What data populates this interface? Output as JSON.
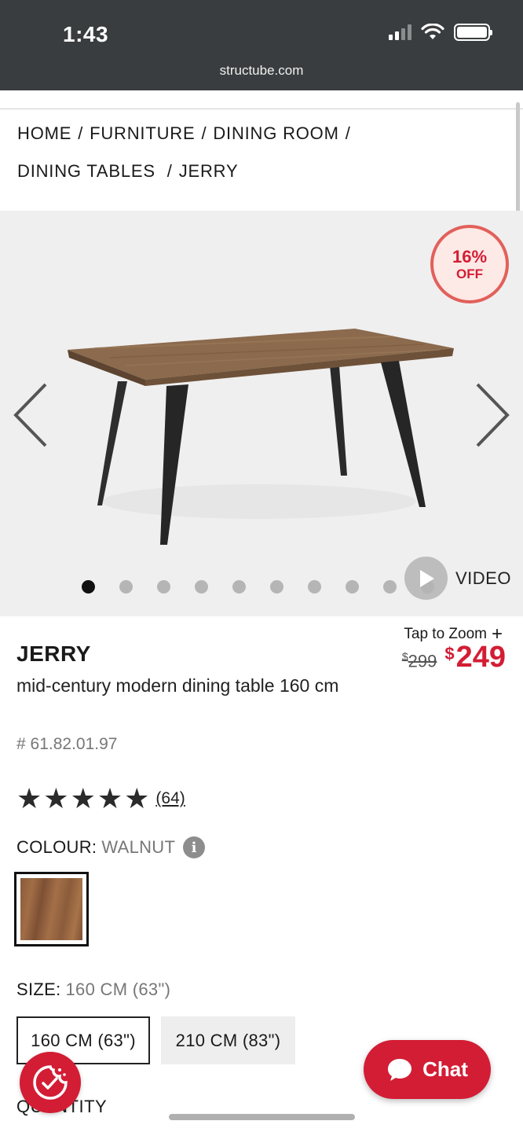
{
  "status_bar": {
    "time": "1:43"
  },
  "browser": {
    "url": "structube.com"
  },
  "breadcrumb": {
    "items": [
      "HOME",
      "FURNITURE",
      "DINING ROOM",
      "DINING TABLES",
      "JERRY"
    ],
    "separator": "/"
  },
  "gallery": {
    "badge": {
      "percent": "16%",
      "label": "OFF"
    },
    "total_images": 10,
    "active_index": 0,
    "video_label": "VIDEO"
  },
  "product": {
    "tap_to_zoom": "Tap to Zoom",
    "name": "JERRY",
    "description": "mid-century modern dining table 160 cm",
    "sku": "# 61.82.01.97",
    "rating": {
      "stars": 5,
      "count_label": "(64)"
    },
    "price": {
      "currency": "$",
      "old": "299",
      "new": "249"
    },
    "colour": {
      "label": "COLOUR:",
      "value": "WALNUT",
      "swatch_color": "#9a6642"
    },
    "size": {
      "label": "SIZE:",
      "value": "160 CM (63\")",
      "options": [
        "160 CM (63\")",
        "210 CM (83\")"
      ]
    },
    "quantity_label": "QUANTITY"
  },
  "chat": {
    "label": "Chat"
  },
  "colors": {
    "brand_red": "#d31d35",
    "badge_border": "#e2605a",
    "status_bar_bg": "#3a3d3f"
  }
}
